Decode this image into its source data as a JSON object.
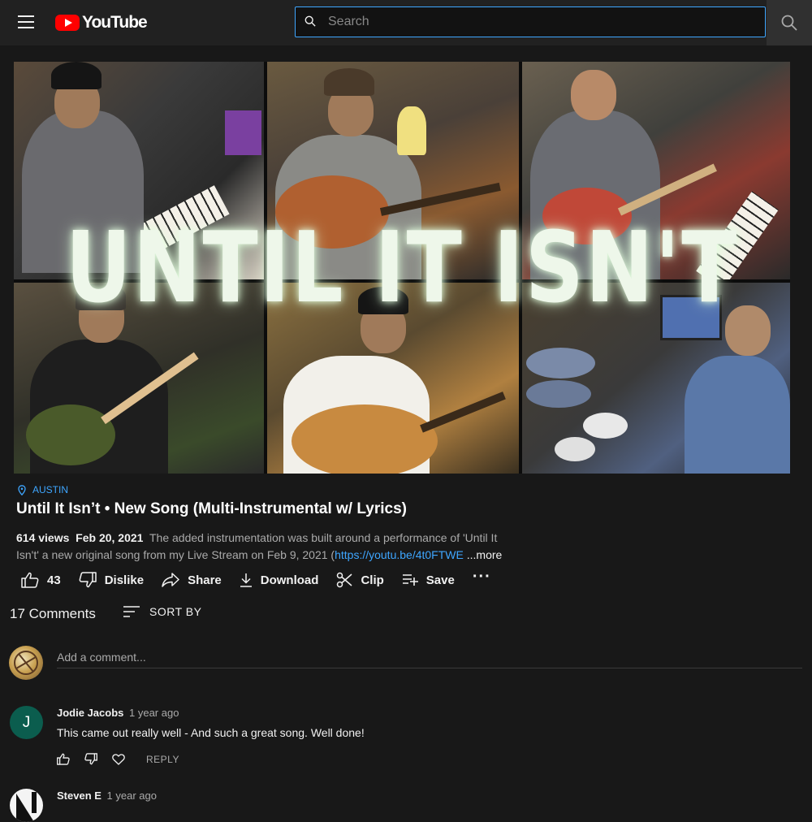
{
  "header": {
    "logo_text": "YouTube",
    "search_placeholder": "Search"
  },
  "video": {
    "overlay_title": "UNTIL IT ISN'T",
    "location": "AUSTIN",
    "title": "Until It Isn’t • New Song (Multi-Instrumental w/ Lyrics)",
    "views": "614 views",
    "date": "Feb 20, 2021",
    "description": "The added instrumentation was built around a performance of 'Until It Isn't' a new original song from my Live Stream on Feb 9, 2021  (",
    "link": "https://youtu.be/4t0FTWE",
    "more": "...more"
  },
  "actions": {
    "likes": "43",
    "dislike": "Dislike",
    "share": "Share",
    "download": "Download",
    "clip": "Clip",
    "save": "Save",
    "more": "···"
  },
  "comments": {
    "count_label": "17 Comments",
    "sort_label": "SORT BY",
    "add_placeholder": "Add a comment...",
    "items": [
      {
        "author": "Jodie Jacobs",
        "time": "1 year ago",
        "text": "This came out really well -   And such a great song.  Well done!",
        "avatar_letter": "J",
        "avatar_color": "#0b5d4e",
        "reply": "REPLY"
      },
      {
        "author": "Steven E",
        "time": "1 year ago"
      }
    ]
  },
  "colors": {
    "accent": "#3ea6ff",
    "brand_red": "#ff0000",
    "background": "#181818"
  }
}
